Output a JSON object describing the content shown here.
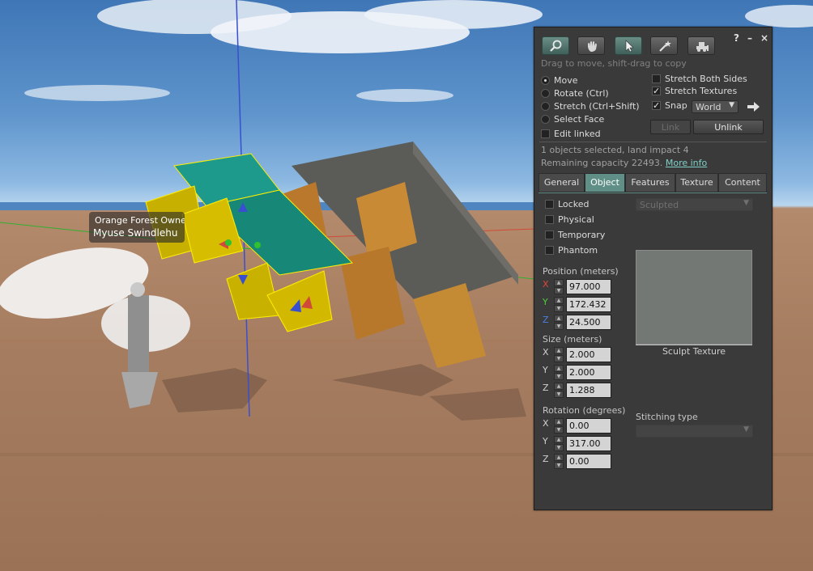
{
  "viewport": {
    "nametag": {
      "line1": "Orange Forest Owne",
      "line2": "Myuse Swindlehu"
    }
  },
  "panel": {
    "controls": {
      "help": "?",
      "minimize": "–",
      "close": "×"
    },
    "tools": [
      {
        "name": "focus",
        "icon": "magnifier-icon",
        "active": true
      },
      {
        "name": "grab",
        "icon": "hand-icon",
        "active": false
      },
      {
        "name": "edit",
        "icon": "arrow-cursor-icon",
        "active": true
      },
      {
        "name": "create",
        "icon": "magic-wand-icon",
        "active": false
      },
      {
        "name": "land",
        "icon": "bulldozer-icon",
        "active": false
      }
    ],
    "hint": "Drag to move, shift-drag to copy",
    "modes": [
      {
        "label": "Move",
        "checked": true
      },
      {
        "label": "Rotate (Ctrl)",
        "checked": false
      },
      {
        "label": "Stretch (Ctrl+Shift)",
        "checked": false
      },
      {
        "label": "Select Face",
        "checked": false
      }
    ],
    "edit_linked": {
      "label": "Edit linked",
      "checked": false
    },
    "stretch_both": {
      "label": "Stretch Both Sides",
      "checked": false
    },
    "stretch_textures": {
      "label": "Stretch Textures",
      "checked": true
    },
    "snap": {
      "label": "Snap",
      "checked": true,
      "value": "World"
    },
    "link_label": "Link",
    "unlink_label": "Unlink",
    "selection_info": "1 objects selected, land impact 4",
    "remaining_capacity": "Remaining capacity 22493.",
    "more_info": "More info",
    "tabs": [
      {
        "label": "General",
        "active": false
      },
      {
        "label": "Object",
        "active": true
      },
      {
        "label": "Features",
        "active": false
      },
      {
        "label": "Texture",
        "active": false
      },
      {
        "label": "Content",
        "active": false
      }
    ],
    "object": {
      "locked": {
        "label": "Locked",
        "checked": false
      },
      "physical": {
        "label": "Physical",
        "checked": false
      },
      "temporary": {
        "label": "Temporary",
        "checked": false
      },
      "phantom": {
        "label": "Phantom",
        "checked": false
      },
      "position": {
        "label": "Position (meters)",
        "x": "97.000",
        "y": "172.432",
        "z": "24.500"
      },
      "size": {
        "label": "Size (meters)",
        "x": "2.000",
        "y": "2.000",
        "z": "1.288"
      },
      "rotation": {
        "label": "Rotation (degrees)",
        "x": "0.00",
        "y": "317.00",
        "z": "0.00"
      },
      "prim_type": "Sculpted",
      "sculpt_texture_label": "Sculpt Texture",
      "stitching_label": "Stitching type",
      "stitching_value": "",
      "axis_labels": {
        "x": "X",
        "y": "Y",
        "z": "Z"
      },
      "axis_colors": {
        "x": "#e0463a",
        "y": "#4fcf3a",
        "z": "#4a7fe0",
        "neutral": "#d0d0d0"
      }
    }
  }
}
